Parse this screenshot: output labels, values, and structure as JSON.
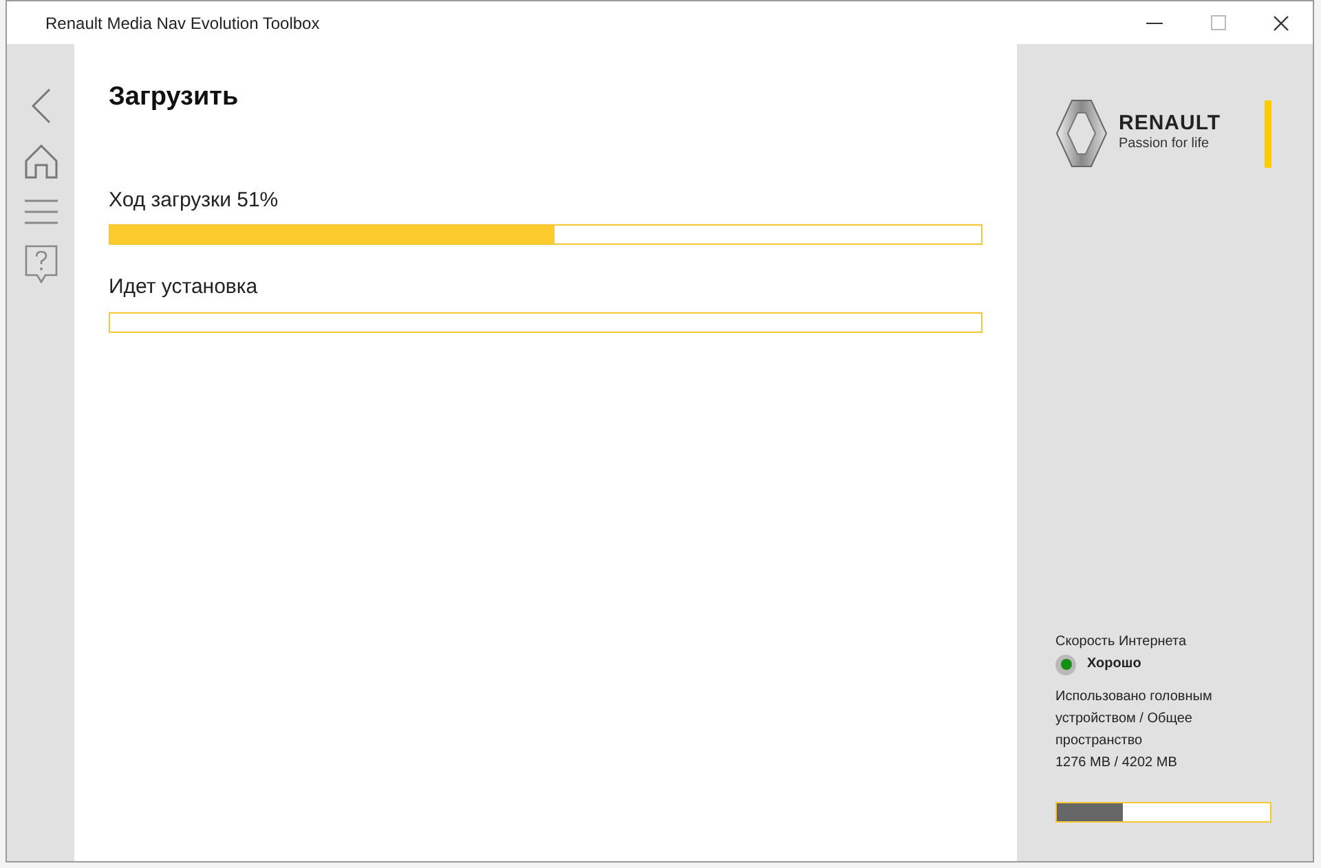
{
  "window": {
    "title": "Renault Media Nav Evolution Toolbox"
  },
  "page": {
    "title": "Загрузить",
    "progress": [
      {
        "label": "Ход загрузки 51%",
        "level": 0.51
      },
      {
        "label": "Идет установка"
      }
    ]
  },
  "brand": {
    "name": "RENAULT",
    "tagline": "Passion for life"
  },
  "internet": {
    "label": "Скорость Интернета",
    "status": "Хорошо",
    "color": "#139013"
  },
  "storage": {
    "label": "Использовано головным устройством / Общее пространство",
    "reading": "1276 MB / 4202 MB",
    "level": 0.31
  }
}
